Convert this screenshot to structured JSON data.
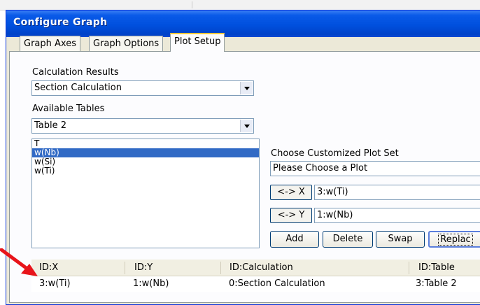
{
  "window": {
    "title": "Configure Graph"
  },
  "tabs": [
    {
      "label": "Graph Axes",
      "active": false
    },
    {
      "label": "Graph Options",
      "active": false
    },
    {
      "label": "Plot Setup",
      "active": true
    }
  ],
  "plot_setup": {
    "calculation_results_label": "Calculation Results",
    "calculation_results_value": "Section Calculation",
    "available_tables_label": "Available Tables",
    "available_tables_value": "Table 2",
    "variables": [
      {
        "label": "T",
        "selected": false
      },
      {
        "label": "w(Nb)",
        "selected": true
      },
      {
        "label": "w(Si)",
        "selected": false
      },
      {
        "label": "w(Ti)",
        "selected": false
      }
    ],
    "choose_plot_set_label": "Choose Customized Plot Set",
    "choose_plot_set_value": "Please Choose a Plot",
    "x_button": "<-> X",
    "x_value": "3:w(Ti)",
    "y_button": "<-> Y",
    "y_value": "1:w(Nb)",
    "buttons": {
      "add": "Add",
      "delete": "Delete",
      "swap": "Swap",
      "replace": "Replac"
    }
  },
  "grid": {
    "columns": [
      "ID:X",
      "ID:Y",
      "ID:Calculation",
      "ID:Table"
    ],
    "rows": [
      [
        "3:w(Ti)",
        "1:w(Nb)",
        "0:Section Calculation",
        "3:Table 2"
      ]
    ]
  },
  "colors": {
    "title_bar": "#0050de",
    "selection": "#316ac5",
    "annotation_arrow": "#e8141a"
  }
}
